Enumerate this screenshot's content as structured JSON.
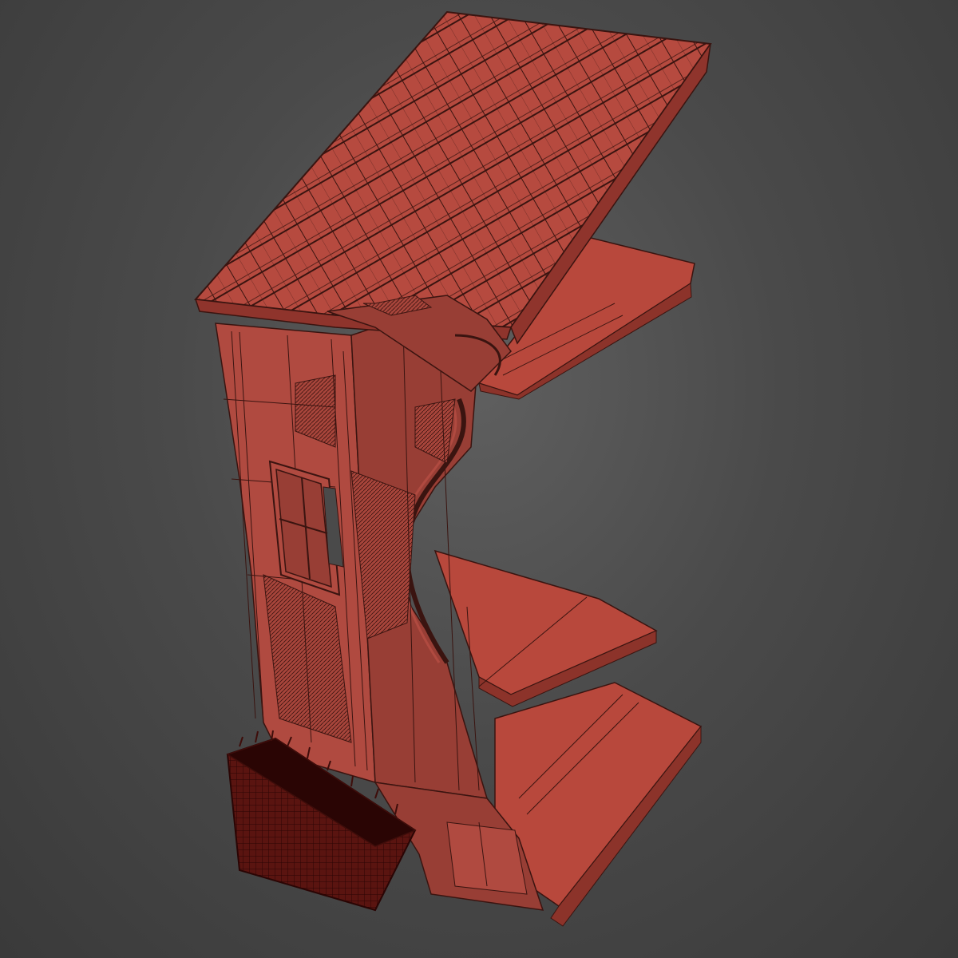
{
  "viewport": {
    "label": "",
    "background_color": "#4a4a4a"
  },
  "model": {
    "description_icon": "wall-section-3d-model",
    "wire_color": "#3a1410",
    "colors": {
      "roof": "#b64a3f",
      "roof_dark": "#8f342c",
      "wall_face": "#b04a40",
      "wall_side": "#983e35",
      "slab": "#b8483c",
      "slab_edge": "#8c332a",
      "planter_fill": "#2a0504",
      "planter_grass": "#3e0d0a"
    }
  }
}
